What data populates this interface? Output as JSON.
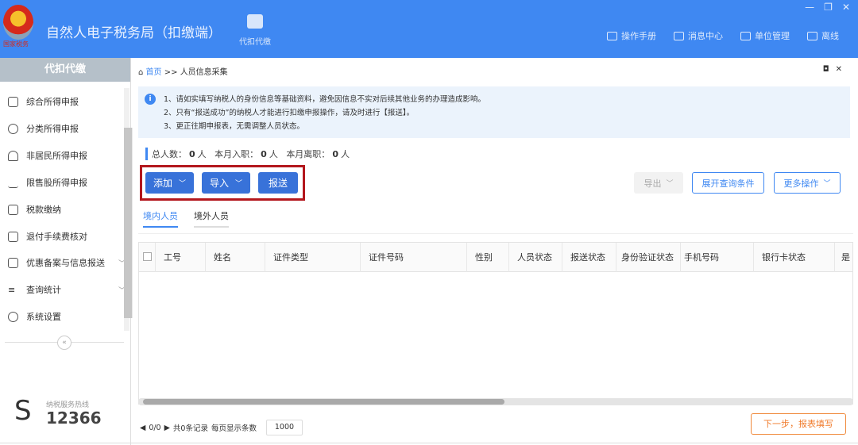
{
  "header": {
    "title": "自然人电子税务局（扣缴端）",
    "emblem_text": "国家税务",
    "nav": "代扣代缴",
    "tools": [
      {
        "icon": "manual-icon",
        "label": "操作手册"
      },
      {
        "icon": "mail-icon",
        "label": "消息中心"
      },
      {
        "icon": "building-icon",
        "label": "单位管理"
      },
      {
        "icon": "offline-icon",
        "label": "离线"
      }
    ],
    "window": {
      "minimize": "—",
      "restore": "❐",
      "close": "✕"
    }
  },
  "sidebar": {
    "title": "代扣代缴",
    "items": [
      {
        "label": "综合所得申报"
      },
      {
        "label": "分类所得申报"
      },
      {
        "label": "非居民所得申报"
      },
      {
        "label": "限售股所得申报"
      },
      {
        "label": "税款缴纳"
      },
      {
        "label": "退付手续费核对"
      },
      {
        "label": "优惠备案与信息报送",
        "expandable": true
      },
      {
        "label": "查询统计",
        "expandable": true
      },
      {
        "label": "系统设置"
      }
    ],
    "collapse": "«",
    "hotline_label": "纳税服务热线",
    "hotline": "12366"
  },
  "breadcrumb": {
    "home": "首页",
    "sep": ">>",
    "current": "人员信息采集"
  },
  "notice": [
    "1、请如实填写纳税人的身份信息等基础资料，避免因信息不实对后续其他业务的办理造成影响。",
    "2、只有“报送成功”的纳税人才能进行扣缴申报操作，请及时进行【报送】。",
    "3、更正往期申报表，无需调整人员状态。"
  ],
  "stats": {
    "total_label": "总人数：",
    "total": "0",
    "unit": "人",
    "hire_label": "本月入职：",
    "hire": "0",
    "leave_label": "本月离职：",
    "leave": "0"
  },
  "buttons": {
    "add": "添加",
    "import": "导入",
    "submit": "报送",
    "export": "导出",
    "expand_query": "展开查询条件",
    "more": "更多操作"
  },
  "tabs": [
    "境内人员",
    "境外人员"
  ],
  "table": {
    "columns": [
      "工号",
      "姓名",
      "证件类型",
      "证件号码",
      "性别",
      "人员状态",
      "报送状态",
      "身份验证状态",
      "手机号码",
      "银行卡状态",
      "是"
    ],
    "rows": []
  },
  "pager": {
    "pages": "0/0",
    "records": "共0条记录",
    "page_size_label": "每页显示条数",
    "page_size": "1000"
  },
  "next_button": "下一步，报表填写",
  "colors": {
    "header": "#3f88f2",
    "primary_button": "#3872d9",
    "highlight_box": "#b3171d",
    "next_button": "#f07a2a"
  }
}
